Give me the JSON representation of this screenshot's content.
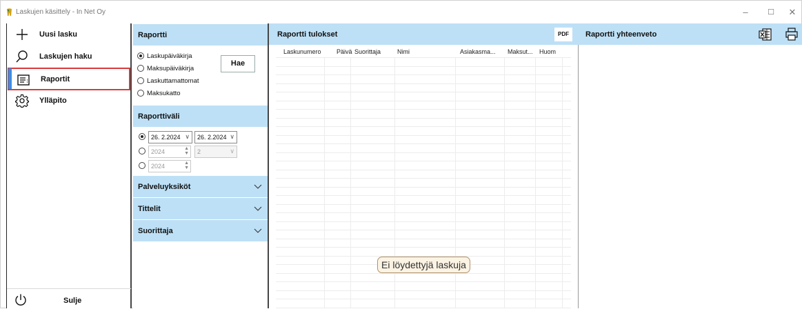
{
  "window": {
    "title": "Laskujen käsittely - In Net Oy",
    "minimize_glyph": "–",
    "maximize_glyph": "☐",
    "close_glyph": "✕"
  },
  "sidebar": {
    "items": [
      {
        "label": "Uusi lasku",
        "icon": "plus-icon"
      },
      {
        "label": "Laskujen haku",
        "icon": "search-icon"
      },
      {
        "label": "Raportit",
        "icon": "report-icon",
        "active": true
      },
      {
        "label": "Ylläpito",
        "icon": "gear-icon"
      }
    ],
    "close": {
      "label": "Sulje",
      "icon": "power-icon"
    }
  },
  "raportti": {
    "title": "Raportti",
    "report_types": [
      {
        "label": "Laskupäiväkirja",
        "selected": true
      },
      {
        "label": "Maksupäiväkirja",
        "selected": false
      },
      {
        "label": "Laskuttamattomat",
        "selected": false
      },
      {
        "label": "Maksukatto",
        "selected": false
      }
    ],
    "search_button": "Hae",
    "range_title": "Raporttiväli",
    "date_from": "26. 2.2024",
    "date_to": "26. 2.2024",
    "year_1": "2024",
    "month_1": "2",
    "year_2": "2024",
    "palveluyksikot": "Palveluyksiköt",
    "tittelit": "Tittelit",
    "suorittaja": "Suorittaja"
  },
  "results": {
    "title": "Raportti tulokset",
    "pdf_button": "PDF",
    "columns": [
      "Laskunumero",
      "Päivä",
      "Suorittaja",
      "Nimi",
      "Asiakasma...",
      "Maksut...",
      "Huom"
    ],
    "empty_message": "Ei löydettyjä laskuja"
  },
  "summary": {
    "title": "Raportti yhteenveto",
    "excel_icon": "excel-icon",
    "print_icon": "printer-icon"
  },
  "colors": {
    "header_bg": "#bde0f6",
    "active_border": "#d83b3b",
    "active_bar": "#3a8ee6"
  }
}
